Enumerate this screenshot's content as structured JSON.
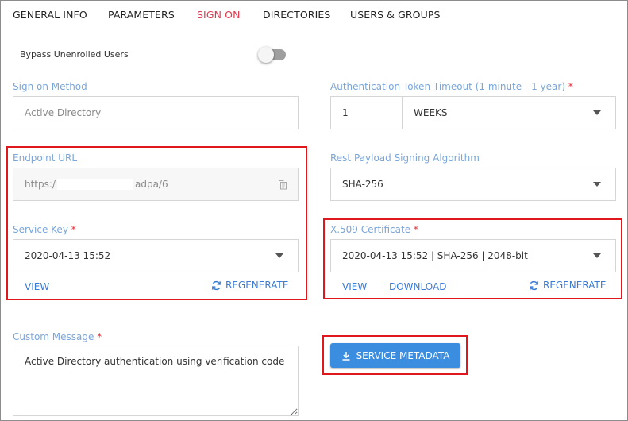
{
  "tabs": [
    {
      "label": "GENERAL INFO"
    },
    {
      "label": "PARAMETERS"
    },
    {
      "label": "SIGN ON"
    },
    {
      "label": "DIRECTORIES"
    },
    {
      "label": "USERS & GROUPS"
    }
  ],
  "active_tab": "SIGN ON",
  "bypass": {
    "label": "Bypass Unenrolled Users",
    "enabled": false
  },
  "sign_on_method": {
    "label": "Sign on Method",
    "value": "Active Directory"
  },
  "token_timeout": {
    "label": "Authentication Token Timeout (1 minute - 1 year)",
    "required_mark": "*",
    "value": "1",
    "unit": "WEEKS"
  },
  "endpoint": {
    "label": "Endpoint URL",
    "value_start": "https:/",
    "value_end": "adpa/6"
  },
  "rest_payload": {
    "label": "Rest Payload Signing Algorithm",
    "value": "SHA-256"
  },
  "service_key": {
    "label": "Service Key",
    "required_mark": "*",
    "value": "2020-04-13 15:52",
    "view_label": "VIEW",
    "regenerate_label": "REGENERATE"
  },
  "certificate": {
    "label": "X.509 Certificate",
    "required_mark": "*",
    "value": "2020-04-13 15:52 | SHA-256 | 2048-bit",
    "view_label": "VIEW",
    "download_label": "DOWNLOAD",
    "regenerate_label": "REGENERATE"
  },
  "custom_message": {
    "label": "Custom Message",
    "required_mark": "*",
    "value": "Active Directory authentication using verification code"
  },
  "service_metadata": {
    "label": "SERVICE METADATA"
  },
  "colors": {
    "accent": "#3b8de0",
    "active_tab": "#e2394f",
    "label": "#7aa6d9",
    "highlight": "#e0181e"
  }
}
